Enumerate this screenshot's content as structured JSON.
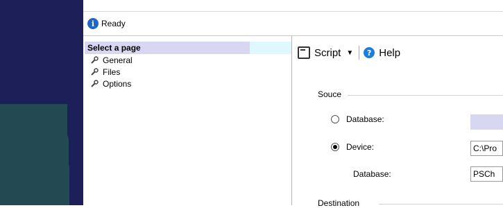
{
  "status": {
    "text": "Ready",
    "icon": "info-icon"
  },
  "select_page": {
    "header": "Select a page",
    "items": [
      {
        "label": "General",
        "icon": "wrench-icon"
      },
      {
        "label": "Files",
        "icon": "wrench-icon"
      },
      {
        "label": "Options",
        "icon": "wrench-icon"
      }
    ]
  },
  "toolbar": {
    "script_label": "Script",
    "help_label": "Help"
  },
  "source": {
    "title": "Souce",
    "database_radio": "Database:",
    "device_radio": "Device:",
    "device_value": "C:\\Pro",
    "database_label": "Database:",
    "database_value": "PSCh",
    "selected": "device"
  },
  "destination": {
    "title": "Destination"
  },
  "colors": {
    "left_background": "#1c1f58",
    "selected_header": "#d7d7f2",
    "accent_blue": "#1f7ed9"
  }
}
